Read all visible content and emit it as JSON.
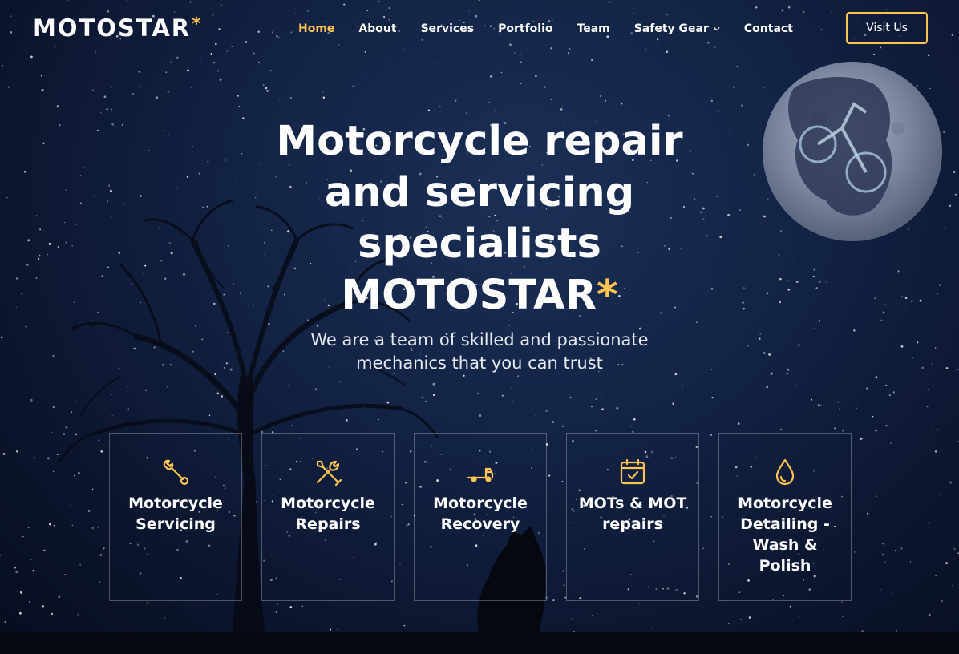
{
  "header": {
    "logo_text": "MOTOSTAR",
    "logo_accent": "*",
    "nav": [
      {
        "label": "Home",
        "active": true
      },
      {
        "label": "About"
      },
      {
        "label": "Services"
      },
      {
        "label": "Portfolio"
      },
      {
        "label": "Team"
      },
      {
        "label": "Safety Gear",
        "has_dropdown": true
      },
      {
        "label": "Contact"
      }
    ],
    "cta_label": "Visit Us"
  },
  "hero": {
    "title": "Motorcycle repair and servicing specialists",
    "brand": "MOTOSTAR",
    "brand_accent": "*",
    "subtitle": "We are a team of skilled and passionate mechanics that you can trust"
  },
  "services": [
    {
      "label": "Motorcycle Servicing",
      "icon": "wrench-icon"
    },
    {
      "label": "Motorcycle Repairs",
      "icon": "tools-icon"
    },
    {
      "label": "Motorcycle Recovery",
      "icon": "truck-icon"
    },
    {
      "label": "MOTs & MOT repairs",
      "icon": "calendar-check-icon"
    },
    {
      "label": "Motorcycle Detailing - Wash & Polish",
      "icon": "droplet-icon"
    }
  ],
  "colors": {
    "accent": "#ffc451",
    "background": "#132446"
  }
}
